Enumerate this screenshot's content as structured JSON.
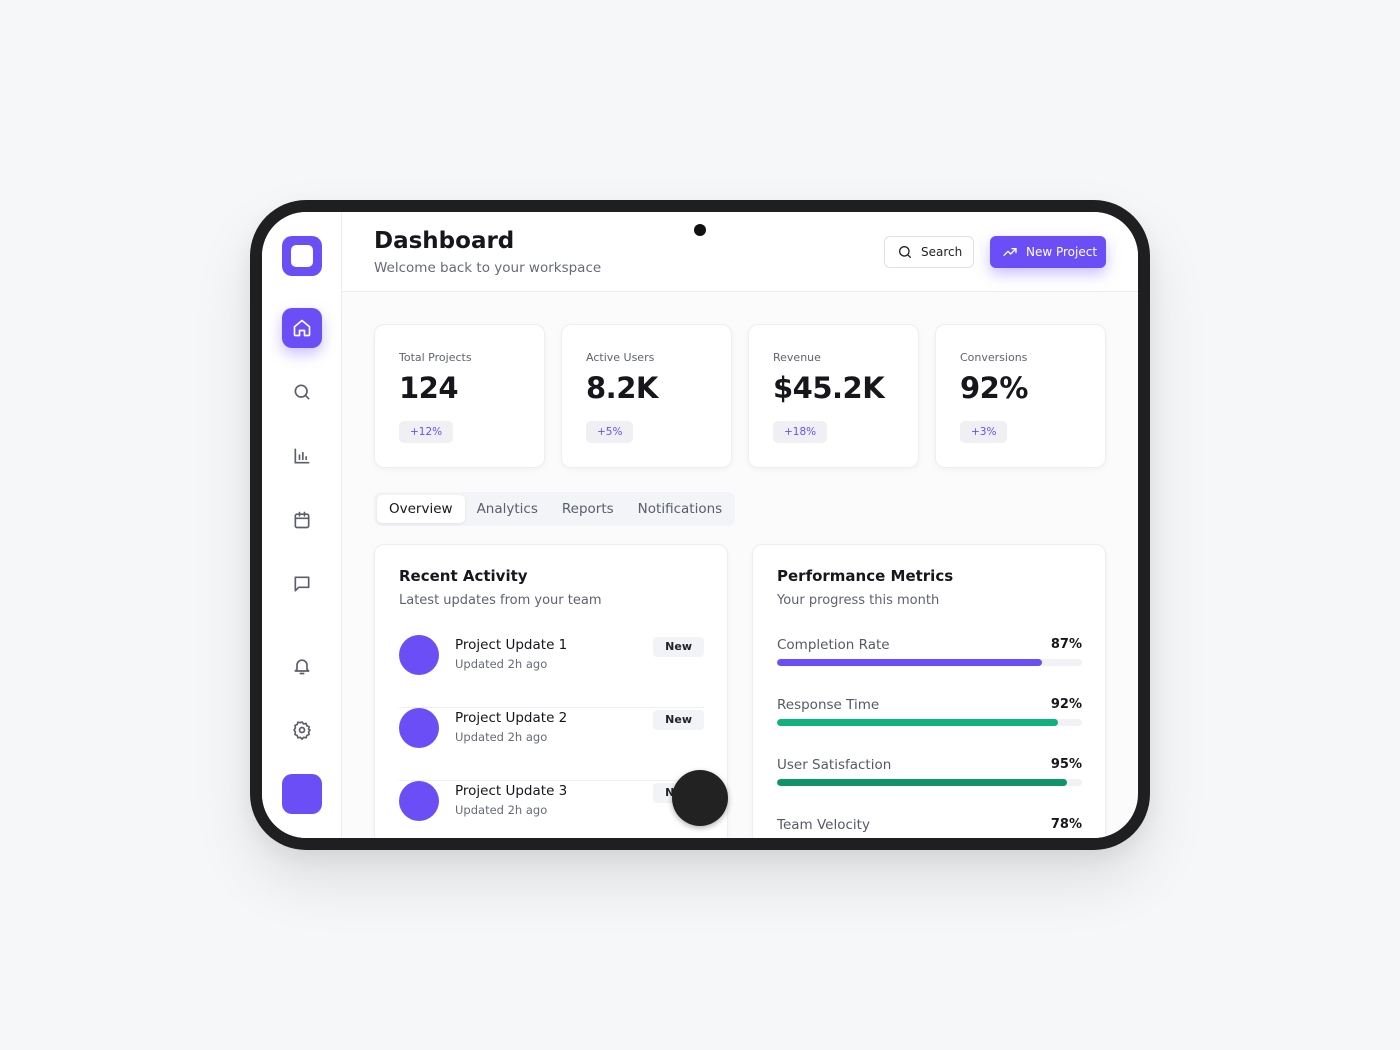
{
  "header": {
    "title": "Dashboard",
    "subtitle": "Welcome back to your workspace",
    "search_label": "Search",
    "new_project_label": "New Project"
  },
  "sidebar": {
    "items": [
      {
        "name": "home",
        "icon": "home-icon",
        "active": true
      },
      {
        "name": "search",
        "icon": "search-icon"
      },
      {
        "name": "analytics",
        "icon": "bar-chart-icon"
      },
      {
        "name": "calendar",
        "icon": "calendar-icon"
      },
      {
        "name": "messages",
        "icon": "message-icon"
      },
      {
        "name": "notifications",
        "icon": "bell-icon"
      },
      {
        "name": "settings",
        "icon": "gear-icon"
      }
    ]
  },
  "stats": [
    {
      "label": "Total Projects",
      "value": "124",
      "change": "+12%"
    },
    {
      "label": "Active Users",
      "value": "8.2K",
      "change": "+5%"
    },
    {
      "label": "Revenue",
      "value": "$45.2K",
      "change": "+18%"
    },
    {
      "label": "Conversions",
      "value": "92%",
      "change": "+3%"
    }
  ],
  "tabs": [
    {
      "label": "Overview",
      "active": true
    },
    {
      "label": "Analytics"
    },
    {
      "label": "Reports"
    },
    {
      "label": "Notifications"
    }
  ],
  "activity": {
    "title": "Recent Activity",
    "subtitle": "Latest updates from your team",
    "items": [
      {
        "title": "Project Update 1",
        "time": "Updated 2h ago",
        "badge": "New"
      },
      {
        "title": "Project Update 2",
        "time": "Updated 2h ago",
        "badge": "New"
      },
      {
        "title": "Project Update 3",
        "time": "Updated 2h ago",
        "badge": "New"
      }
    ]
  },
  "performance": {
    "title": "Performance Metrics",
    "subtitle": "Your progress this month",
    "metrics": [
      {
        "label": "Completion Rate",
        "value": "87%",
        "progress": 0.87,
        "color": "#6b4ef5"
      },
      {
        "label": "Response Time",
        "value": "92%",
        "progress": 0.92,
        "color": "#10b07f"
      },
      {
        "label": "User Satisfaction",
        "value": "95%",
        "progress": 0.95,
        "color": "#0e9468"
      },
      {
        "label": "Team Velocity",
        "value": "78%",
        "progress": 0.78,
        "color": "#6b4ef5"
      }
    ]
  },
  "colors": {
    "accent": "#6b4ef5",
    "success": "#10b07f"
  }
}
